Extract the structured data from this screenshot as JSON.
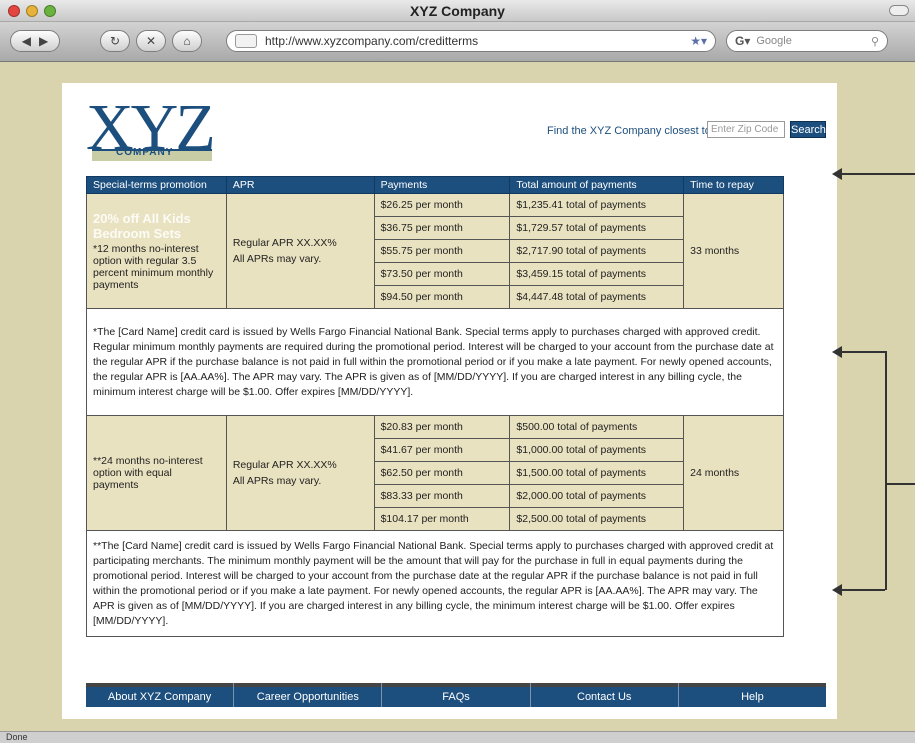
{
  "window": {
    "title": "XYZ Company"
  },
  "browser": {
    "url": "http://www.xyzcompany.com/creditterms",
    "search_placeholder": "Google",
    "status": "Done"
  },
  "header": {
    "logo_text": "XYZ",
    "logo_sub": "COMPANY",
    "find_label": "Find the XYZ Company closest to you:",
    "zip_placeholder": "Enter Zip Code",
    "search_label": "Search"
  },
  "table": {
    "headers": [
      "Special-terms promotion",
      "APR",
      "Payments",
      "Total amount of payments",
      "Time to repay"
    ],
    "ghost_text": "20% off All Kids Bedroom Sets",
    "group1": {
      "promotion": "*12 months no-interest option with regular 3.5 percent minimum monthly payments",
      "apr_line1": "Regular APR XX.XX%",
      "apr_line2": "All APRs may vary.",
      "time": "33 months",
      "rows": [
        {
          "payment": "$26.25 per month",
          "total": "$1,235.41 total of payments"
        },
        {
          "payment": "$36.75 per month",
          "total": "$1,729.57 total of payments"
        },
        {
          "payment": "$55.75 per month",
          "total": "$2,717.90 total of payments"
        },
        {
          "payment": "$73.50 per month",
          "total": "$3,459.15 total of payments"
        },
        {
          "payment": "$94.50 per month",
          "total": "$4,447.48 total of payments"
        }
      ],
      "note": "*The [Card Name] credit card is issued by Wells Fargo Financial National Bank. Special terms apply to purchases charged with approved credit. Regular minimum monthly payments are required during the promotional period. Interest will be charged to your account from the purchase date at the regular APR if the purchase balance is not paid in full within the promotional period or if you make a late payment. For newly opened accounts, the regular APR is [AA.AA%]. The APR may vary. The APR is given as of [MM/DD/YYYY]. If you are charged interest in any billing cycle, the minimum interest charge will be $1.00. Offer expires [MM/DD/YYYY]."
    },
    "group2": {
      "promotion": "**24 months no-interest option with equal payments",
      "apr_line1": "Regular APR XX.XX%",
      "apr_line2": "All APRs may vary.",
      "time": "24 months",
      "rows": [
        {
          "payment": "$20.83 per month",
          "total": "$500.00 total of payments"
        },
        {
          "payment": "$41.67 per month",
          "total": "$1,000.00 total of payments"
        },
        {
          "payment": "$62.50 per month",
          "total": "$1,500.00 total of payments"
        },
        {
          "payment": "$83.33 per month",
          "total": "$2,000.00 total of payments"
        },
        {
          "payment": "$104.17 per month",
          "total": "$2,500.00 total of payments"
        }
      ],
      "note": "**The [Card Name] credit card is issued by Wells Fargo Financial National Bank. Special terms apply to purchases charged with approved credit at participating merchants. The minimum monthly payment will be the amount that will pay for the purchase in full in equal payments during the promotional period. Interest will be charged to your account from the purchase date at the regular APR if the purchase balance is not paid in full within the promotional period or if you make a late payment. For newly opened accounts, the regular APR is [AA.AA%]. The APR may vary. The APR is given as of [MM/DD/YYYY]. If you are charged interest in any billing cycle, the minimum interest charge will be $1.00. Offer expires [MM/DD/YYYY]."
    }
  },
  "footer": {
    "items": [
      "About XYZ Company",
      "Career Opportunities",
      "FAQs",
      "Contact Us",
      "Help"
    ]
  }
}
